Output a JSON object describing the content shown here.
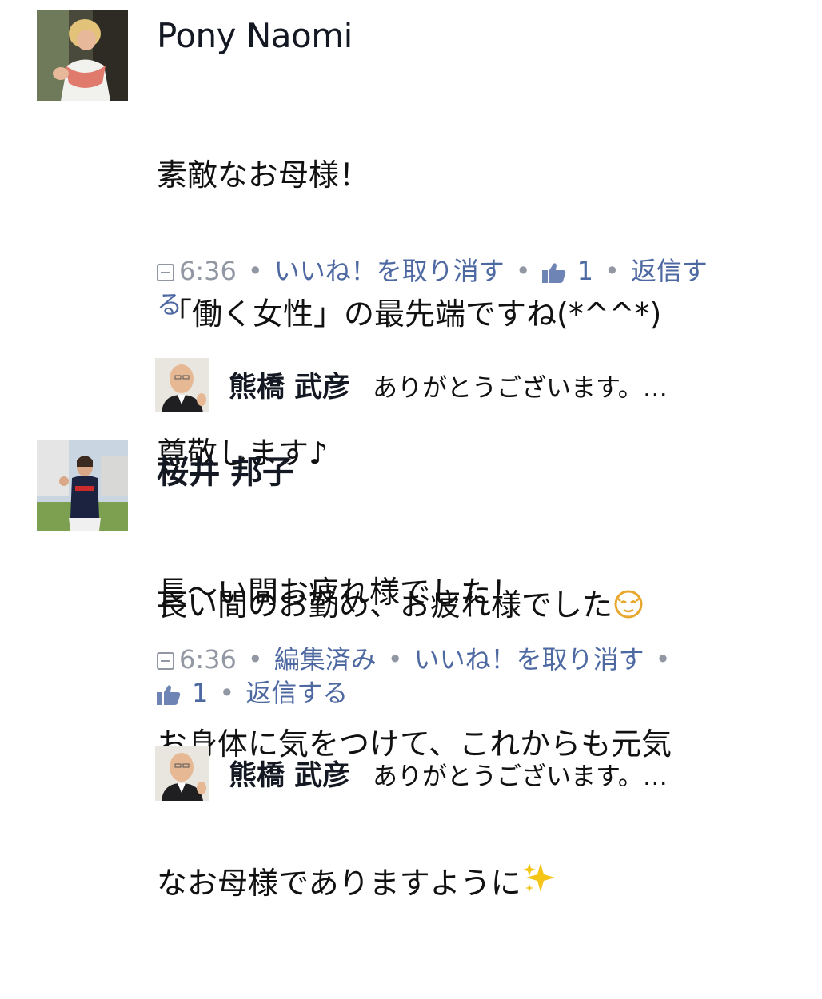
{
  "comments": [
    {
      "author": "Pony Naomi",
      "lines": [
        "素敵なお母様！",
        "「働く女性」の最先端ですね(*^^*)",
        "尊敬します♪",
        "長〜い間お疲れ様でした！"
      ],
      "time": "6:36",
      "unlike_label": "いいね！を取り消す",
      "like_count": "1",
      "reply_label_a": "返信す",
      "reply_label_b": "る",
      "reply": {
        "author": "熊橋 武彦",
        "text": "ありがとうございます。…"
      }
    },
    {
      "author": "桜井 邦子",
      "lines": [
        "長い間のお勤め、お疲れ様でした",
        "お身体に気をつけて、これからも元気",
        "なお母様でありますように"
      ],
      "time": "6:36",
      "edited_label": "編集済み",
      "unlike_label": "いいね！を取り消す",
      "like_count": "1",
      "reply_label": "返信する",
      "reply": {
        "author": "熊橋 武彦",
        "text": "ありがとうございます。…"
      }
    }
  ],
  "colors": {
    "link": "#4e69a2",
    "meta": "#9197a3",
    "name": "#141823"
  },
  "icons": [
    "clock-icon",
    "thumbs-up-icon",
    "relieved-face-emoji",
    "sparkles-emoji"
  ]
}
